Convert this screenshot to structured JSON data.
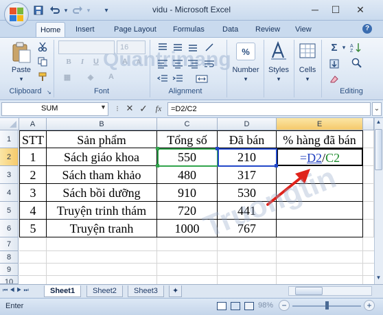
{
  "window": {
    "title": "vidu - Microsoft Excel",
    "minimize": "─",
    "restore": "☐",
    "close": "✕"
  },
  "qat": {
    "save_icon": "save-icon",
    "undo_icon": "undo-icon",
    "redo_icon": "redo-icon"
  },
  "tabs": [
    "Home",
    "Insert",
    "Page Layout",
    "Formulas",
    "Data",
    "Review",
    "View"
  ],
  "ribbon": {
    "clipboard": {
      "label": "Clipboard",
      "paste": "Paste"
    },
    "font": {
      "label": "Font",
      "size": "16"
    },
    "alignment": {
      "label": "Alignment"
    },
    "number": {
      "label": "Number",
      "symbol": "%"
    },
    "styles": {
      "label": "Styles"
    },
    "cells": {
      "label": "Cells"
    },
    "editing": {
      "label": "Editing"
    }
  },
  "formula_bar": {
    "name_box": "SUM",
    "fx": "fx",
    "cancel": "✕",
    "enter": "✓",
    "formula": "=D2/C2"
  },
  "columns": [
    "A",
    "B",
    "C",
    "D",
    "E"
  ],
  "rows": [
    "1",
    "2",
    "3",
    "4",
    "5",
    "6",
    "7",
    "8",
    "9",
    "10"
  ],
  "table": {
    "header": [
      "STT",
      "Sản phẩm",
      "Tổng số",
      "Đã bán",
      "% hàng đã bán"
    ],
    "data": [
      [
        "1",
        "Sách giáo khoa",
        "550",
        "210"
      ],
      [
        "2",
        "Sách tham khảo",
        "480",
        "317"
      ],
      [
        "3",
        "Sách bồi dưỡng",
        "910",
        "530"
      ],
      [
        "4",
        "Truyện trinh thám",
        "720",
        "441"
      ],
      [
        "5",
        "Truyện tranh",
        "1000",
        "767"
      ]
    ],
    "e2_formula": {
      "eq": "=",
      "d2": "D2",
      "slash": "/",
      "c2": "C2"
    }
  },
  "sheets": [
    "Sheet1",
    "Sheet2",
    "Sheet3"
  ],
  "status": {
    "mode": "Enter",
    "zoom": "98%"
  },
  "colors": {
    "accent": "#2b4f80",
    "d2_ref": "#1f3fbf",
    "c2_ref": "#1a8a2a",
    "arrow": "#e0231b"
  }
}
